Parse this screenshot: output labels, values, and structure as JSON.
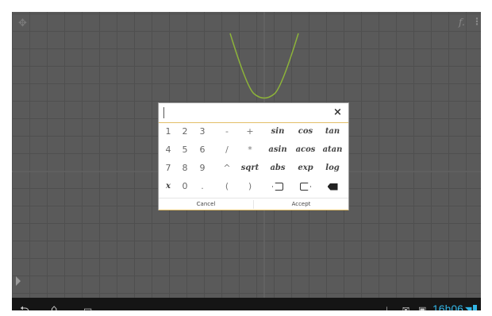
{
  "topbar": {
    "fx_label": "f.",
    "menu_label": "⋮"
  },
  "dialog": {
    "input_value": "",
    "close_label": "×",
    "keys": [
      [
        "1",
        "2",
        "3",
        "-",
        "+",
        "sin",
        "cos",
        "tan"
      ],
      [
        "4",
        "5",
        "6",
        "/",
        "*",
        "asin",
        "acos",
        "atan"
      ],
      [
        "7",
        "8",
        "9",
        "^",
        "sqrt",
        "abs",
        "exp",
        "log"
      ],
      [
        "x",
        "0",
        ".",
        "(",
        ")",
        "",
        "",
        ""
      ]
    ],
    "cancel_label": "Cancel",
    "accept_label": "Accept"
  },
  "statusbar": {
    "time": "16h06"
  },
  "colors": {
    "accent": "#e3bf68",
    "clock": "#33b5e5",
    "curve": "#8db33a"
  },
  "icons": {
    "back": "back-icon",
    "home": "home-icon",
    "recents": "recents-icon",
    "download": "download-icon",
    "notification": "notification-icon",
    "screenshot": "screenshot-icon",
    "wifi": "wifi-icon",
    "battery": "battery-icon",
    "tag_left": "tag-left-icon",
    "tag_right": "tag-right-icon",
    "backspace": "backspace-icon"
  }
}
